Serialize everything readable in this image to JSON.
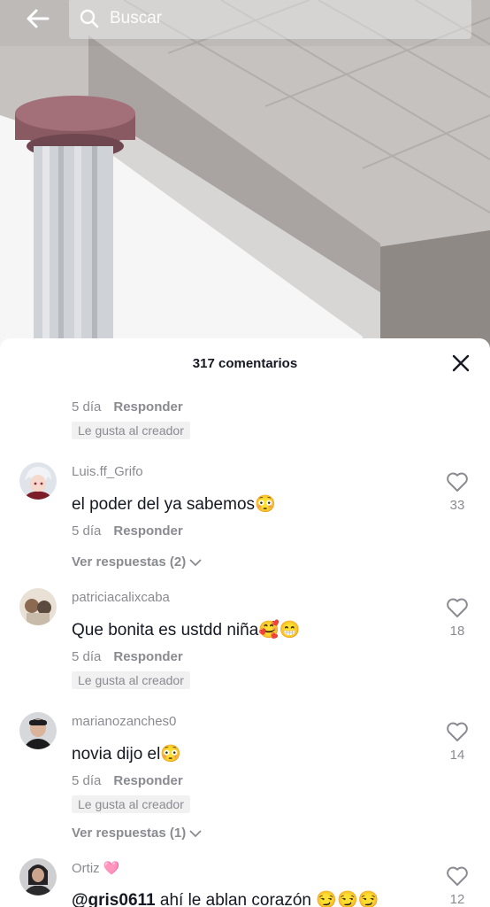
{
  "search": {
    "placeholder": "Buscar"
  },
  "sheet": {
    "title": "317 comentarios"
  },
  "partial_comment": {
    "time": "5 día",
    "reply_label": "Responder",
    "creator_badge": "Le gusta al creador"
  },
  "comments": [
    {
      "username": "Luis.ff_Grifo",
      "text": "el poder del ya sabemos",
      "emoji": "😳",
      "time": "5 día",
      "reply_label": "Responder",
      "likes": "33",
      "view_replies": "Ver respuestas (2)"
    },
    {
      "username": "patriciacalixcaba",
      "text": "Que bonita es ustdd niña",
      "emoji": "🥰😁",
      "time": "5 día",
      "reply_label": "Responder",
      "creator_badge": "Le gusta al creador",
      "likes": "18"
    },
    {
      "username": "marianozanches0",
      "text": "novia dijo el",
      "emoji": "😳",
      "time": "5 día",
      "reply_label": "Responder",
      "creator_badge": "Le gusta al creador",
      "likes": "14",
      "view_replies": "Ver respuestas (1)"
    },
    {
      "username": "Ortiz",
      "username_emoji": "🩷",
      "mention": "@gris0611",
      "text": " ahí le ablan corazón ",
      "emoji": "😏😏😏",
      "likes": "12"
    }
  ],
  "icons": {
    "back": "arrow-left-icon",
    "search": "search-icon",
    "close": "close-icon",
    "like": "heart-outline-icon",
    "chevron": "chevron-down-icon"
  },
  "colors": {
    "text": "#161823",
    "muted": "#8a8b91",
    "badge_bg": "#f1f1f2"
  }
}
